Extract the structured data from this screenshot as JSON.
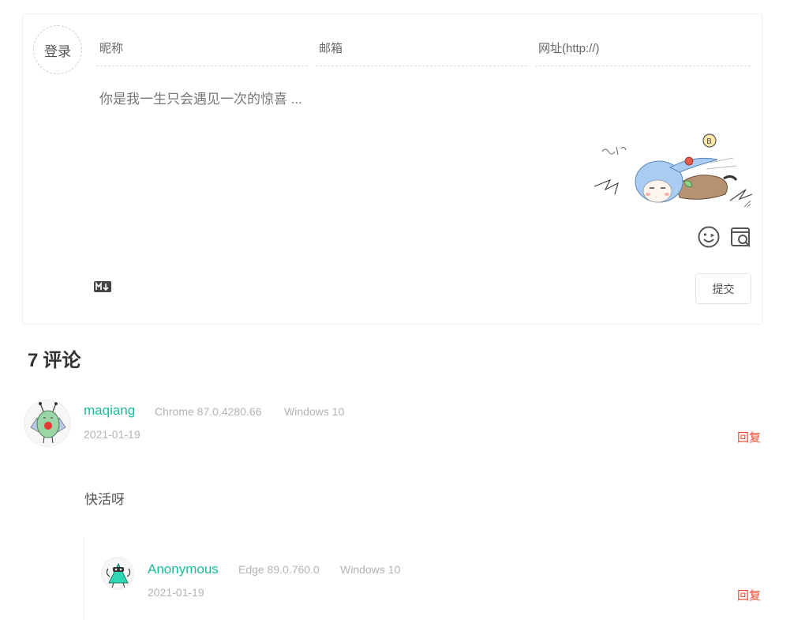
{
  "form": {
    "login_label": "登录",
    "nick_placeholder": "昵称",
    "mail_placeholder": "邮箱",
    "url_placeholder": "网址(http://)",
    "editor_placeholder": "你是我一生只会遇见一次的惊喜 ...",
    "submit_label": "提交",
    "icons": {
      "emoji": "emoji-icon",
      "preview": "preview-icon",
      "markdown": "markdown-icon",
      "art": "anime-character-illustration"
    }
  },
  "comments_header": {
    "count": "7",
    "label": "评论"
  },
  "comments": [
    {
      "nick": "maqiang",
      "browser": "Chrome 87.0.4280.66",
      "os": "Windows 10",
      "date": "2021-01-19",
      "reply_label": "回复",
      "content": "快活呀"
    },
    {
      "nick": "Anonymous",
      "browser": "Edge 89.0.760.0",
      "os": "Windows 10",
      "date": "2021-01-19",
      "reply_label": "回复"
    }
  ],
  "colors": {
    "nick": "#1abc9c",
    "reply": "#ef4a2e",
    "meta": "#b3b3b3",
    "border": "#eeeeee"
  }
}
